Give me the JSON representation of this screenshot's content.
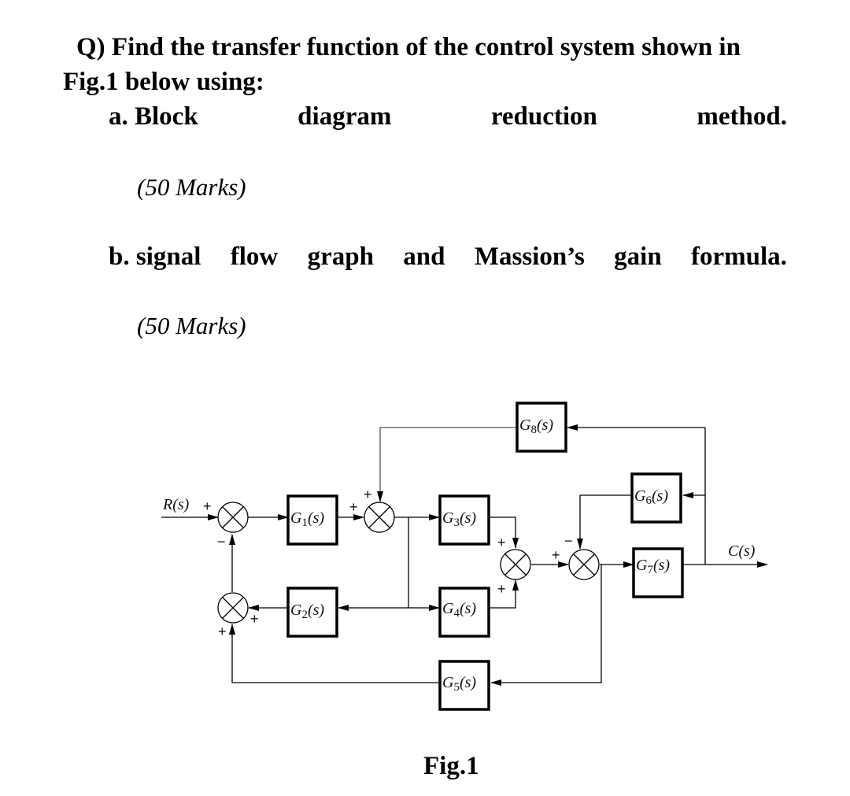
{
  "question": {
    "line1": "Q)  Find the transfer function of the control system shown in",
    "line2": "Fig.1 below using:",
    "part_a_words": [
      "a. Block",
      "diagram",
      "reduction",
      "method."
    ],
    "part_a_marks": "(50 Marks)",
    "part_b_words": [
      "b. signal",
      "flow",
      "graph",
      "and",
      "Massion’s",
      "gain",
      "formula."
    ],
    "part_b_marks": "(50 Marks)"
  },
  "figure": {
    "caption": "Fig.1",
    "input_label": "R(s)",
    "output_label": "C(s)",
    "blocks": [
      {
        "id": "G1",
        "base": "G",
        "sub": "1",
        "arg": "(s)"
      },
      {
        "id": "G2",
        "base": "G",
        "sub": "2",
        "arg": "(s)"
      },
      {
        "id": "G3",
        "base": "G",
        "sub": "3",
        "arg": "(s)"
      },
      {
        "id": "G4",
        "base": "G",
        "sub": "4",
        "arg": "(s)"
      },
      {
        "id": "G5",
        "base": "G",
        "sub": "5",
        "arg": "(s)"
      },
      {
        "id": "G6",
        "base": "G",
        "sub": "6",
        "arg": "(s)"
      },
      {
        "id": "G7",
        "base": "G",
        "sub": "7",
        "arg": "(s)"
      },
      {
        "id": "G8",
        "base": "G",
        "sub": "8",
        "arg": "(s)"
      }
    ],
    "signs": {
      "s1_input": "+",
      "s1_feedback": "−",
      "s2_left": "+",
      "s2_top": "+",
      "s3_top": "+",
      "s3_bottom": "+",
      "s4_left": "+",
      "s4_top": "−",
      "s5_right": "+",
      "s5_bottom": "+"
    }
  }
}
